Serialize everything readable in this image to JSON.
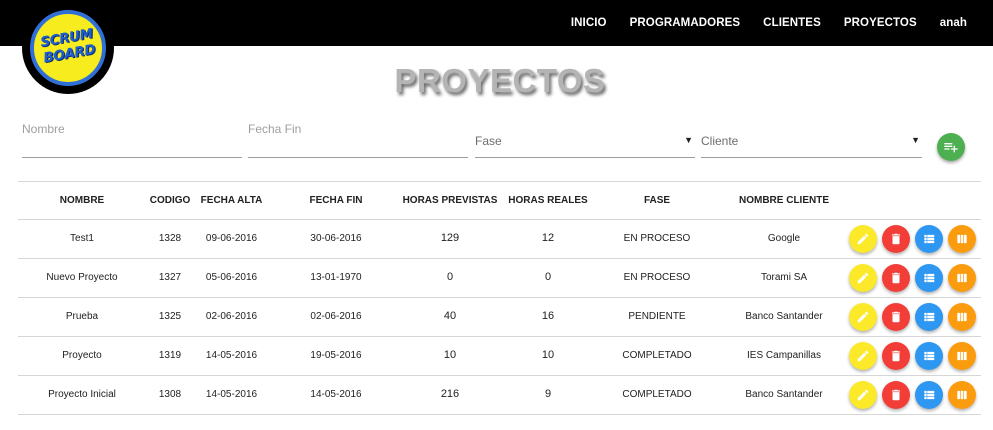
{
  "nav": {
    "items": [
      {
        "label": "INICIO"
      },
      {
        "label": "PROGRAMADORES"
      },
      {
        "label": "CLIENTES"
      },
      {
        "label": "PROYECTOS"
      },
      {
        "label": "anah"
      }
    ]
  },
  "logo": {
    "line1": "SCRUM",
    "line2": "BOARD"
  },
  "page": {
    "title": "PROYECTOS"
  },
  "filters": {
    "nombre_placeholder": "Nombre",
    "nombre_value": "",
    "fecha_fin_placeholder": "Fecha Fin",
    "fecha_fin_value": "",
    "fase_selected": "Fase",
    "cliente_selected": "Cliente"
  },
  "colors": {
    "accent_add": "#4caf50",
    "edit": "#fbe92a",
    "delete": "#f23e37",
    "list": "#2d97f1",
    "board": "#fb9c0e"
  },
  "icons": {
    "add": "playlist-add-icon",
    "edit": "pencil-icon",
    "delete": "trash-icon",
    "list": "list-icon",
    "board": "columns-icon"
  },
  "table": {
    "headers": [
      "NOMBRE",
      "CODIGO",
      "FECHA ALTA",
      "FECHA FIN",
      "HORAS PREVISTAS",
      "HORAS REALES",
      "FASE",
      "NOMBRE CLIENTE"
    ],
    "rows": [
      [
        "Test1",
        "1328",
        "09-06-2016",
        "30-06-2016",
        "129",
        "12",
        "EN PROCESO",
        "Google"
      ],
      [
        "Nuevo Proyecto",
        "1327",
        "05-06-2016",
        "13-01-1970",
        "0",
        "0",
        "EN PROCESO",
        "Torami SA"
      ],
      [
        "Prueba",
        "1325",
        "02-06-2016",
        "02-06-2016",
        "40",
        "16",
        "PENDIENTE",
        "Banco Santander"
      ],
      [
        "Proyecto",
        "1319",
        "14-05-2016",
        "19-05-2016",
        "10",
        "10",
        "COMPLETADO",
        "IES Campanillas"
      ],
      [
        "Proyecto Inicial",
        "1308",
        "14-05-2016",
        "14-05-2016",
        "216",
        "9",
        "COMPLETADO",
        "Banco Santander"
      ]
    ]
  }
}
